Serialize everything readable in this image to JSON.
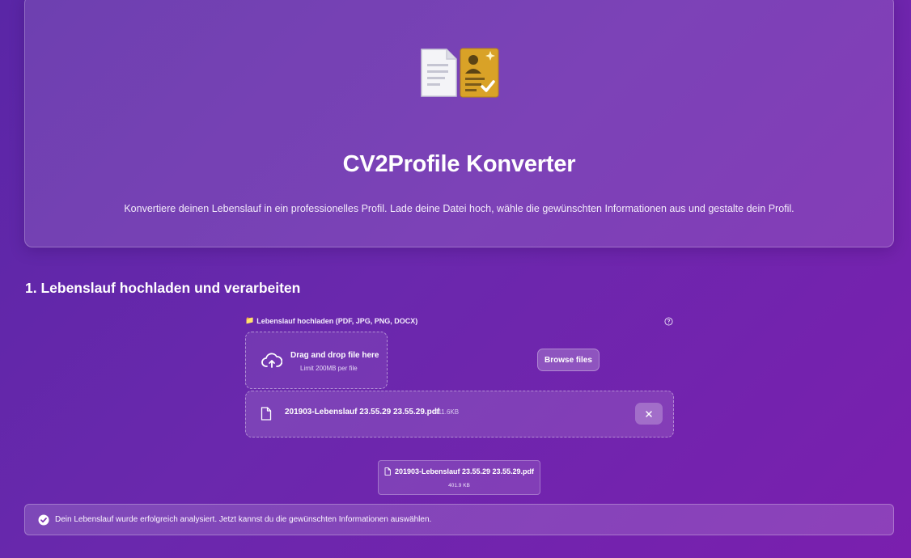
{
  "hero": {
    "icon_names": [
      "document-icon",
      "profile-card-icon"
    ],
    "title": "CV2Profile Konverter",
    "subtitle": "Konvertiere deinen Lebenslauf in ein professionelles Profil. Lade deine Datei hoch, wähle die gewünschten Informationen aus und gestalte dein Profil."
  },
  "section": {
    "title": "1. Lebenslauf hochladen und verarbeiten"
  },
  "uploader": {
    "label_icon": "📁",
    "label": "Lebenslauf hochladen (PDF, JPG, PNG, DOCX)",
    "help_icon": "question-circle-icon",
    "dropzone_icon": "cloud-upload-icon",
    "dropzone_title": "Drag and drop file here",
    "dropzone_limit": "Limit 200MB per file",
    "browse_label": "Browse files"
  },
  "uploaded_file": {
    "icon": "file-icon",
    "name": "201903-Lebenslauf 23.55.29 23.55.29.pdf",
    "size": "411.6KB",
    "remove_icon": "close-icon"
  },
  "file_card": {
    "name": "201903-Lebenslauf 23.55.29 23.55.29.pdf",
    "size": "401.9 KB"
  },
  "status": {
    "icon": "check-circle-icon",
    "message": "Dein Lebenslauf wurde erfolgreich analysiert. Jetzt kannst du die gewünschten Informationen auswählen."
  },
  "colors": {
    "background_start": "#5a26a6",
    "background_end": "#7a1fae",
    "card_gold": "#d9a227"
  }
}
